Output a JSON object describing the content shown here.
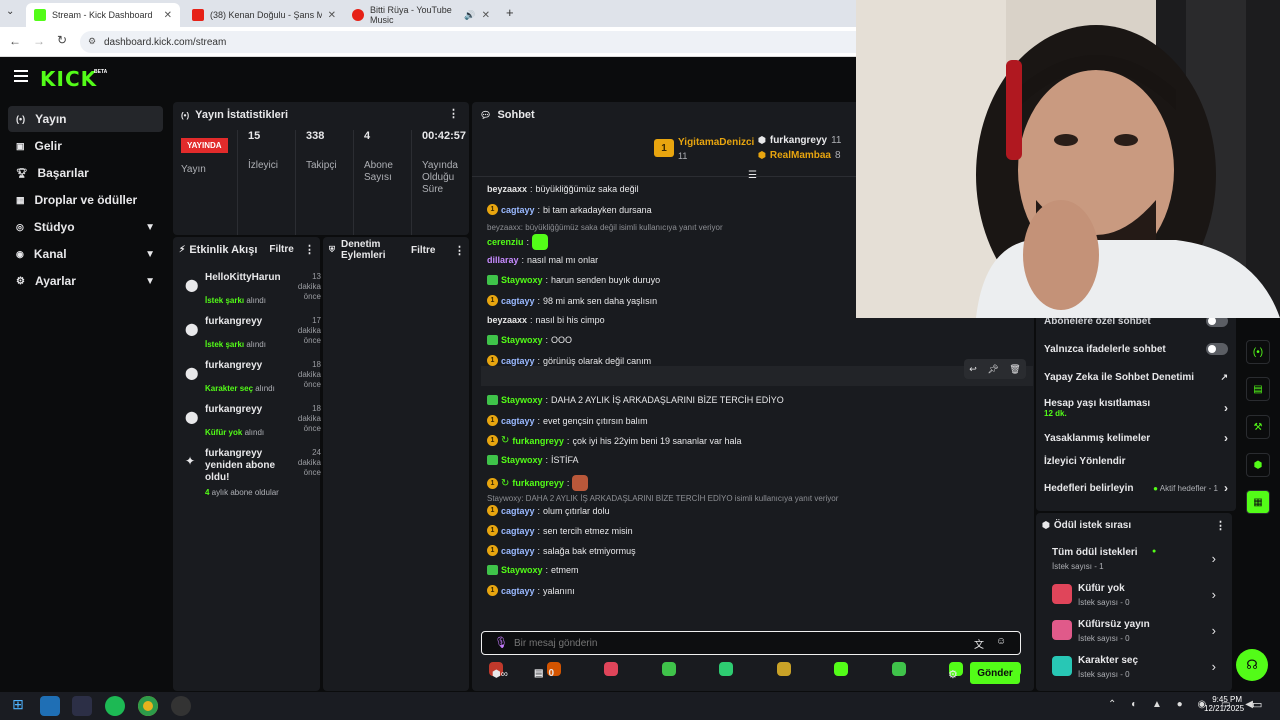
{
  "browser": {
    "tabs": [
      {
        "label": "Stream - Kick Dashboard"
      },
      {
        "label": "(38) Kenan Doğulu - Şans Mele"
      },
      {
        "label": "Bitti Rüya - YouTube Music"
      }
    ],
    "url": "dashboard.kick.com/stream"
  },
  "brand": {
    "logo": "KICK",
    "tag": "BETA",
    "accent": "#53fc18"
  },
  "sidebar": {
    "items": [
      {
        "label": "Yayın",
        "icon": "broadcast-icon"
      },
      {
        "label": "Gelir",
        "icon": "wallet-icon"
      },
      {
        "label": "Başarılar",
        "icon": "trophy-icon"
      },
      {
        "label": "Droplar ve ödüller",
        "icon": "gift-icon"
      },
      {
        "label": "Stüdyo",
        "icon": "studio-icon"
      },
      {
        "label": "Kanal",
        "icon": "channel-icon"
      },
      {
        "label": "Ayarlar",
        "icon": "gear-icon"
      }
    ]
  },
  "stats": {
    "title": "Yayın İstatistikleri",
    "live_badge": "YAYINDA",
    "live_label": "Yayın",
    "viewers": "15",
    "viewers_label": "İzleyici",
    "followers": "338",
    "followers_label": "Takipçi",
    "subs": "4",
    "subs_label": "Abone Sayısı",
    "duration": "00:42:57",
    "duration_label": "Yayında Olduğu Süre"
  },
  "activity": {
    "title": "Etkinlik Akışı",
    "filter": "Filtre",
    "items": [
      {
        "name": "HelloKittyHarun",
        "time": "13 dakika önce",
        "sub_hl": "İstek şarkı",
        "sub": " alındı"
      },
      {
        "name": "furkangreyy",
        "time": "17 dakika önce",
        "sub_hl": "İstek şarkı",
        "sub": " alındı"
      },
      {
        "name": "furkangreyy",
        "time": "18 dakika önce",
        "sub_hl": "Karakter seç",
        "sub": " alındı"
      },
      {
        "name": "furkangreyy",
        "time": "18 dakika önce",
        "sub_hl": "Küfür yok",
        "sub": " alındı"
      },
      {
        "name": "furkangreyy yeniden abone oldu!",
        "time": "24 dakika önce",
        "sub_hl": "4",
        "sub": " aylık abone oldular"
      }
    ]
  },
  "moderation": {
    "title": "Denetim Eylemleri",
    "filter": "Filtre"
  },
  "chat": {
    "title": "Sohbet",
    "pinned": [
      {
        "name": "YigitamaDenizci",
        "count": "11"
      },
      {
        "name": "furkangreyy",
        "count": "11"
      },
      {
        "name": "RealMambaa",
        "count": "8"
      }
    ],
    "messages": [
      {
        "user": "beyzaaxx",
        "text": "büyükliğğümüz saka değil",
        "badge": "none",
        "color": "#e6e6e6"
      },
      {
        "user": "cagtayy",
        "text": "bi tam arkadayken dursana",
        "badge": "gold",
        "color": "#9ab9ff"
      },
      {
        "reply": "beyzaaxx: büyükliğğümüz saka değil isimli kullanıcıya yanıt veriyor"
      },
      {
        "user": "cerenziu",
        "text": "",
        "badge": "none",
        "color": "#53fc18",
        "emote": true
      },
      {
        "user": "dillaray",
        "text": "nasıl mal mı onlar",
        "badge": "none",
        "color": "#c78bff"
      },
      {
        "user": "Staywoxy",
        "text": "harun senden buyık duruyo",
        "badge": "green",
        "color": "#53fc18"
      },
      {
        "user": "cagtayy",
        "text": "98 mi amk sen daha yaşlısın",
        "badge": "gold",
        "color": "#9ab9ff"
      },
      {
        "user": "beyzaaxx",
        "text": "nasıl bi his cimpo",
        "badge": "none",
        "color": "#e6e6e6"
      },
      {
        "user": "Staywoxy",
        "text": "OOO",
        "badge": "green",
        "color": "#53fc18"
      },
      {
        "user": "cagtayy",
        "text": "görünüş olarak değil canım",
        "badge": "gold",
        "color": "#9ab9ff"
      },
      {
        "user": "cagtayy",
        "text": "ben daha yaşlı biliyordum",
        "badge": "gold",
        "color": "#9ab9ff",
        "hover": true
      },
      {
        "user": "Staywoxy",
        "text": "DAHA 2 AYLIK İŞ ARKADAŞLARINI BİZE TERCİH EDİYO",
        "badge": "green",
        "color": "#53fc18"
      },
      {
        "user": "cagtayy",
        "text": "evet gençsin çıtırsın balım",
        "badge": "gold",
        "color": "#9ab9ff"
      },
      {
        "user": "furkangreyy",
        "text": "çok iyi his 22yim beni 19 sananlar var hala",
        "badge": "gold2",
        "color": "#53fc18"
      },
      {
        "user": "Staywoxy",
        "text": "İSTİFA",
        "badge": "green",
        "color": "#53fc18"
      },
      {
        "user": "furkangreyy",
        "text": "",
        "badge": "gold2",
        "color": "#53fc18",
        "emote": true
      },
      {
        "reply": "Staywoxy: DAHA 2 AYLIK İŞ ARKADAŞLARINI BİZE TERCİH EDİYO isimli kullanıcıya yanıt veriyor"
      },
      {
        "user": "cagtayy",
        "text": "olum çıtırlar dolu",
        "badge": "gold",
        "color": "#9ab9ff"
      },
      {
        "user": "cagtayy",
        "text": "sen tercih etmez misin",
        "badge": "gold",
        "color": "#9ab9ff"
      },
      {
        "user": "cagtayy",
        "text": "salağa bak etmiyormuş",
        "badge": "gold",
        "color": "#9ab9ff"
      },
      {
        "user": "Staywoxy",
        "text": "etmem",
        "badge": "green",
        "color": "#53fc18"
      },
      {
        "user": "cagtayy",
        "text": "yalanını",
        "badge": "gold",
        "color": "#9ab9ff"
      }
    ],
    "input_placeholder": "Bir mesaj gönderin",
    "points": "0",
    "send": "Gönder"
  },
  "settings": {
    "rows": [
      {
        "label": "Abonelere özel sohbet",
        "type": "toggle"
      },
      {
        "label": "Yalnızca ifadelerle sohbet",
        "type": "toggle"
      },
      {
        "label": "Yapay Zeka ile Sohbet Denetimi",
        "type": "link"
      },
      {
        "label": "Hesap yaşı kısıtlaması",
        "sub": "12 dk.",
        "type": "chevron"
      },
      {
        "label": "Yasaklanmış kelimeler",
        "type": "chevron"
      },
      {
        "label": "İzleyici Yönlendir",
        "type": "none"
      },
      {
        "label": "Hedefleri belirleyin",
        "extra": "Aktif hedefler - 1",
        "type": "chevron"
      }
    ]
  },
  "rewards": {
    "title": "Ödül istek sırası",
    "items": [
      {
        "title": "Tüm ödül istekleri",
        "sub": "İstek sayısı - 1",
        "color": ""
      },
      {
        "title": "Küfür yok",
        "sub": "İstek sayısı - 0",
        "color": "#e0455a"
      },
      {
        "title": "Küfürsüz yayın",
        "sub": "İstek sayısı - 0",
        "color": "#e05a8a"
      },
      {
        "title": "Karakter seç",
        "sub": "İstek sayısı - 0",
        "color": "#28c7b5"
      }
    ]
  },
  "taskbar": {
    "time": "9:45 PM",
    "date": "12/21/2025"
  }
}
